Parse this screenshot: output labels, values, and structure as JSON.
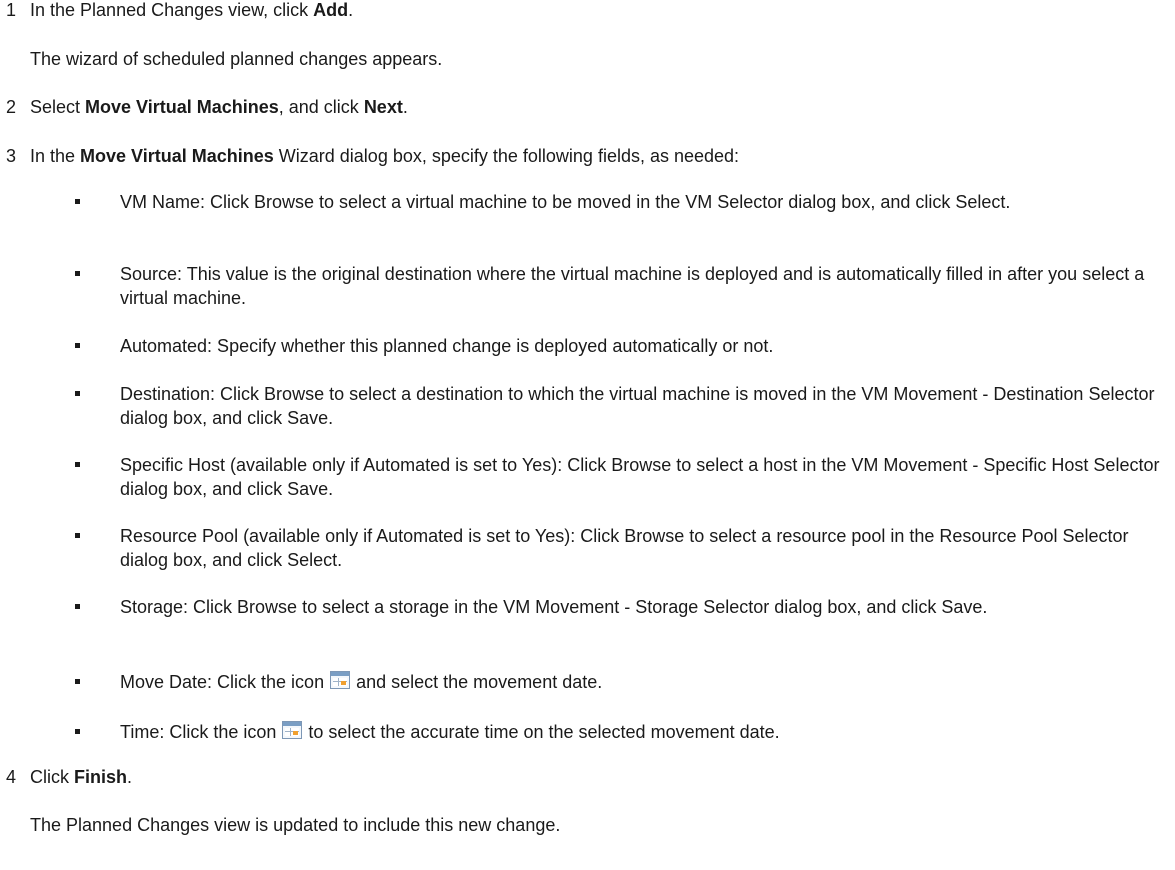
{
  "steps": [
    {
      "num": "1",
      "pre": "In the Planned Changes view, click ",
      "bold": "Add",
      "post": ".",
      "note": "The wizard of scheduled planned changes appears."
    },
    {
      "num": "2",
      "pre": "Select ",
      "bold1": "Move Virtual Machines",
      "mid": ", and click ",
      "bold2": "Next",
      "post": "."
    },
    {
      "num": "3",
      "pre": "In the ",
      "bold": "Move Virtual Machines",
      "post": " Wizard dialog box, specify the following fields, as needed:",
      "bullets": [
        "VM Name: Click Browse to select a virtual machine to be moved in the VM Selector dialog box, and click Select.",
        "Source: This value is the original destination where the virtual machine is deployed and is automatically filled in after you select a virtual machine.",
        "Automated: Specify whether this planned change is deployed automatically or not.",
        "Destination: Click Browse to select a destination to which the virtual machine is moved in the VM Movement - Destination Selector dialog box, and click Save.",
        "Specific Host (available only if Automated is set to Yes): Click Browse to select a host in the VM Movement - Specific Host Selector dialog box, and click Save.",
        "Resource Pool (available only if Automated is set to Yes): Click Browse to select a resource pool in the Resource Pool Selector dialog box, and click Select.",
        "Storage: Click Browse to select a storage in the VM Movement - Storage Selector dialog box, and click Save."
      ],
      "move_date": {
        "pre": "Move Date: Click the icon",
        "icon": "calendar-icon",
        "post": "and select the movement date."
      },
      "time": {
        "pre": "Time: Click the icon",
        "icon": "calendar-icon",
        "post": "to select the accurate time on the selected movement date."
      }
    },
    {
      "num": "4",
      "pre": "Click ",
      "bold": "Finish",
      "post": ".",
      "note": "The Planned Changes view is updated to include this new change."
    }
  ]
}
